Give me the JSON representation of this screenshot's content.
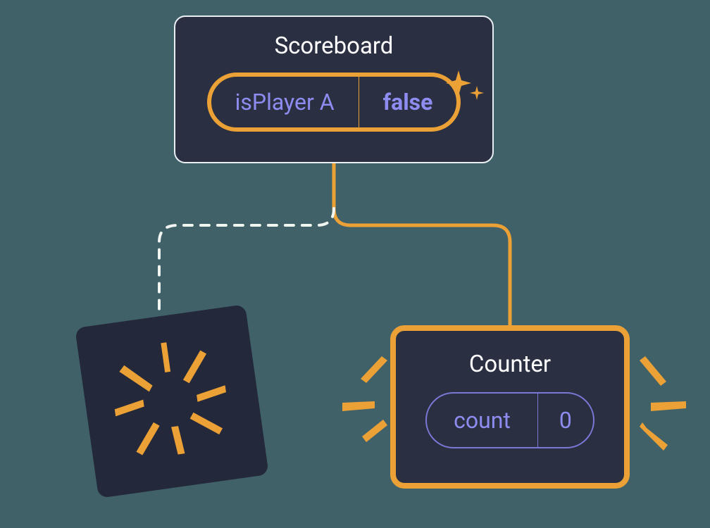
{
  "scoreboard": {
    "title": "Scoreboard",
    "prop_name": "isPlayer A",
    "prop_value": "false"
  },
  "counter": {
    "title": "Counter",
    "state_name": "count",
    "state_value": "0"
  },
  "colors": {
    "accent": "#eba135",
    "panel": "#2a3042",
    "lavender": "#8e8cf0"
  }
}
